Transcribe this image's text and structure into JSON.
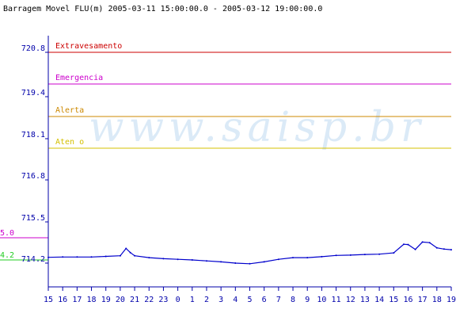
{
  "title": "Barragem Movel FLU(m) 2005-03-11 15:00:00.0 - 2005-03-12 19:00:00.0",
  "watermark": "www.saisp.br",
  "colors": {
    "axis": "#0000aa",
    "series": "#0000cc",
    "extravasamento": "#cc0000",
    "emergencia": "#cc00cc",
    "alerta": "#cc8800",
    "atencao": "#d4c000",
    "side_magenta": "#cc00cc",
    "side_green": "#22cc22"
  },
  "chart_data": {
    "type": "line",
    "title": "Barragem Movel FLU(m) 2005-03-11 15:00:00.0 - 2005-03-12 19:00:00.0",
    "xlabel": "",
    "ylabel": "",
    "ylim": [
      713.9,
      721.1
    ],
    "y_ticks": [
      "720.8",
      "719.4",
      "718.1",
      "716.8",
      "715.5",
      "714.2"
    ],
    "y_tick_values": [
      720.8,
      719.4,
      718.1,
      716.8,
      715.5,
      714.2
    ],
    "x_ticks": [
      "15",
      "16",
      "17",
      "18",
      "19",
      "20",
      "21",
      "22",
      "23",
      "0",
      "1",
      "2",
      "3",
      "4",
      "5",
      "6",
      "7",
      "8",
      "9",
      "10",
      "11",
      "12",
      "13",
      "14",
      "15",
      "16",
      "17",
      "18",
      "19"
    ],
    "reference_lines": [
      {
        "label": "Extravesamento",
        "value": 720.8,
        "color": "#cc0000"
      },
      {
        "label": "Emergencia",
        "value": 719.8,
        "color": "#cc00cc"
      },
      {
        "label": "Alerta",
        "value": 718.8,
        "color": "#cc8800"
      },
      {
        "label": "Aten  o",
        "value": 717.8,
        "color": "#d4c000"
      }
    ],
    "side_markers": [
      {
        "label": "5.0",
        "value": 715.0,
        "color": "#cc00cc"
      },
      {
        "label": "4.2",
        "value": 714.3,
        "color": "#22cc22"
      }
    ],
    "grid": false,
    "series": [
      {
        "x": [
          0,
          1,
          2,
          3,
          4,
          5,
          5.4,
          5.7,
          6,
          7,
          8,
          9,
          10,
          11,
          12,
          13,
          14,
          15,
          16,
          17,
          18,
          19,
          20,
          21,
          22,
          23,
          24,
          24.7,
          25,
          25.5,
          26,
          26.5,
          27,
          27.5,
          28
        ],
        "values": [
          714.38,
          714.39,
          714.39,
          714.39,
          714.41,
          714.43,
          714.66,
          714.53,
          714.43,
          714.37,
          714.34,
          714.32,
          714.3,
          714.27,
          714.24,
          714.2,
          714.18,
          714.24,
          714.32,
          714.37,
          714.37,
          714.4,
          714.44,
          714.45,
          714.47,
          714.48,
          714.52,
          714.79,
          714.78,
          714.63,
          714.86,
          714.84,
          714.68,
          714.64,
          714.62
        ]
      }
    ]
  }
}
